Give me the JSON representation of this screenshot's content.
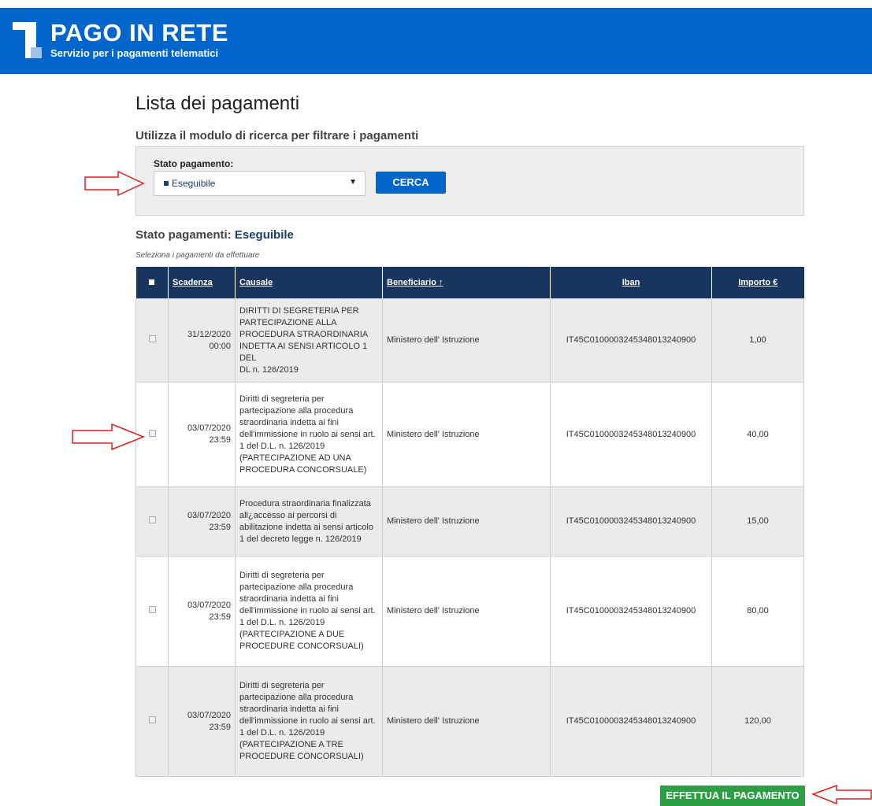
{
  "header": {
    "title": "PAGO IN RETE",
    "subtitle": "Servizio per i pagamenti telematici"
  },
  "page_title": "Lista dei pagamenti",
  "search_subtitle": "Utilizza il modulo di ricerca per filtrare i pagamenti",
  "filter": {
    "label": "Stato pagamento:",
    "selected": "Eseguibile",
    "search_button": "CERCA"
  },
  "status_line": {
    "label": "Stato pagamenti:",
    "value": "Eseguibile"
  },
  "hint": "Seleziona i pagamenti da effettuare",
  "table": {
    "headers": [
      "Scadenza",
      "Causale",
      "Beneficiario ↑",
      "Iban",
      "Importo €"
    ],
    "rows": [
      {
        "date": "31/12/2020",
        "time": "00:00",
        "causale": [
          "DIRITTI DI SEGRETERIA PER",
          "PARTECIPAZIONE ALLA",
          "PROCEDURA STRAORDINARIA",
          "INDETTA AI SENSI ARTICOLO 1 DEL",
          "DL n. 126/2019"
        ],
        "beneficiario": "Ministero dell' Istruzione",
        "iban": "IT45C0100003245348013240900",
        "importo": "1,00"
      },
      {
        "date": "03/07/2020",
        "time": "23:59",
        "causale": [
          "Diritti di segreteria per",
          "partecipazione alla procedura",
          "straordinaria indetta ai fini",
          "dell'immissione in ruolo ai sensi art.",
          "1 del D.L. n. 126/2019",
          "(PARTECIPAZIONE AD UNA",
          "PROCEDURA CONCORSUALE)"
        ],
        "beneficiario": "Ministero dell' Istruzione",
        "iban": "IT45C0100003245348013240900",
        "importo": "40,00"
      },
      {
        "date": "03/07/2020",
        "time": "23:59",
        "causale": [
          "Procedura straordinaria finalizzata",
          "all¿accesso ai percorsi di",
          "abilitazione indetta ai sensi articolo",
          "1 del decreto legge n. 126/2019"
        ],
        "beneficiario": "Ministero dell' Istruzione",
        "iban": "IT45C0100003245348013240900",
        "importo": "15,00"
      },
      {
        "date": "03/07/2020",
        "time": "23:59",
        "causale": [
          "Diritti di segreteria per",
          "partecipazione alla procedura",
          "straordinaria indetta ai fini",
          "dell'immissione in ruolo ai sensi art.",
          "1 del D.L. n. 126/2019",
          "(PARTECIPAZIONE A DUE",
          "PROCEDURE CONCORSUALI)"
        ],
        "beneficiario": "Ministero dell' Istruzione",
        "iban": "IT45C0100003245348013240900",
        "importo": "80,00"
      },
      {
        "date": "03/07/2020",
        "time": "23:59",
        "causale": [
          "Diritti di segreteria per",
          "partecipazione alla procedura",
          "straordinaria indetta ai fini",
          "dell'immissione in ruolo ai sensi art.",
          "1 del D.L. n. 126/2019",
          "(PARTECIPAZIONE A TRE",
          "PROCEDURE CONCORSUALI)"
        ],
        "beneficiario": "Ministero dell' Istruzione",
        "iban": "IT45C0100003245348013240900",
        "importo": "120,00"
      }
    ]
  },
  "pay_button": "EFFETTUA IL PAGAMENTO",
  "colors": {
    "brand_blue": "#0066cc",
    "table_header": "#18355e",
    "pay_green": "#2e9e44",
    "annotation_red": "#e02020"
  }
}
